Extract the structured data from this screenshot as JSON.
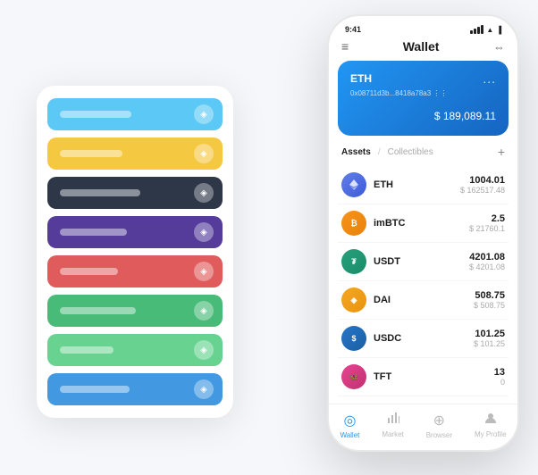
{
  "scene": {
    "cardStack": {
      "cards": [
        {
          "color": "#5bc8f5",
          "lineWidth": 80
        },
        {
          "color": "#f5c842",
          "lineWidth": 70
        },
        {
          "color": "#2d3748",
          "lineWidth": 90
        },
        {
          "color": "#553c9a",
          "lineWidth": 75
        },
        {
          "color": "#e05c5c",
          "lineWidth": 65
        },
        {
          "color": "#48bb78",
          "lineWidth": 85
        },
        {
          "color": "#68d391",
          "lineWidth": 60
        },
        {
          "color": "#4299e1",
          "lineWidth": 78
        }
      ]
    }
  },
  "phone": {
    "statusBar": {
      "time": "9:41"
    },
    "header": {
      "title": "Wallet",
      "menuIcon": "≡",
      "expandIcon": "⇔"
    },
    "ethCard": {
      "label": "ETH",
      "address": "0x08711d3b...8418a78a3  ⋮⋮",
      "balance": "$ 189,089.11",
      "currencySign": "$",
      "moreIcon": "..."
    },
    "assets": {
      "activeTab": "Assets",
      "inactiveTab": "Collectibles",
      "divider": "/",
      "addIcon": "+",
      "items": [
        {
          "symbol": "ETH",
          "amount": "1004.01",
          "usd": "$ 162517.48",
          "iconType": "eth"
        },
        {
          "symbol": "imBTC",
          "amount": "2.5",
          "usd": "$ 21760.1",
          "iconType": "imbtc"
        },
        {
          "symbol": "USDT",
          "amount": "4201.08",
          "usd": "$ 4201.08",
          "iconType": "usdt"
        },
        {
          "symbol": "DAI",
          "amount": "508.75",
          "usd": "$ 508.75",
          "iconType": "dai"
        },
        {
          "symbol": "USDC",
          "amount": "101.25",
          "usd": "$ 101.25",
          "iconType": "usdc"
        },
        {
          "symbol": "TFT",
          "amount": "13",
          "usd": "0",
          "iconType": "tft"
        }
      ]
    },
    "bottomNav": [
      {
        "id": "wallet",
        "label": "Wallet",
        "icon": "◎",
        "active": true
      },
      {
        "id": "market",
        "label": "Market",
        "icon": "📊",
        "active": false
      },
      {
        "id": "browser",
        "label": "Browser",
        "icon": "⊕",
        "active": false
      },
      {
        "id": "profile",
        "label": "My Profile",
        "icon": "👤",
        "active": false
      }
    ]
  }
}
